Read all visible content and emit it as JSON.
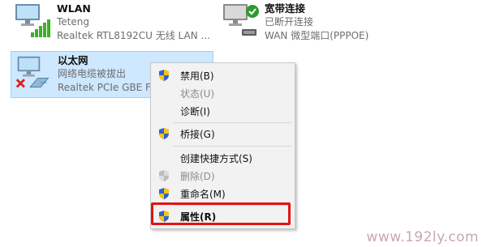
{
  "adapters": {
    "wlan": {
      "name": "WLAN",
      "status": "Teteng",
      "device": "Realtek RTL8192CU 无线 LAN ..."
    },
    "broadband": {
      "name": "宽带连接",
      "status": "已断开连接",
      "device": "WAN 微型端口(PPPOE)"
    },
    "ethernet": {
      "name": "以太网",
      "status": "网络电缆被拔出",
      "device": "Realtek PCIe GBE Fa"
    }
  },
  "context_menu": {
    "items": [
      {
        "label": "禁用(B)",
        "shield": true,
        "enabled": true
      },
      {
        "label": "状态(U)",
        "shield": false,
        "enabled": false
      },
      {
        "label": "诊断(I)",
        "shield": false,
        "enabled": true
      },
      {
        "label": "桥接(G)",
        "shield": true,
        "enabled": true
      },
      {
        "label": "创建快捷方式(S)",
        "shield": false,
        "enabled": true
      },
      {
        "label": "删除(D)",
        "shield": true,
        "enabled": false
      },
      {
        "label": "重命名(M)",
        "shield": true,
        "enabled": true
      },
      {
        "label": "属性(R)",
        "shield": true,
        "enabled": true,
        "bold": true
      }
    ]
  },
  "watermark": "www.192ly.com",
  "colors": {
    "selection": "#cde8ff",
    "highlight_box": "#e11414",
    "signal": "#3fae2a"
  }
}
